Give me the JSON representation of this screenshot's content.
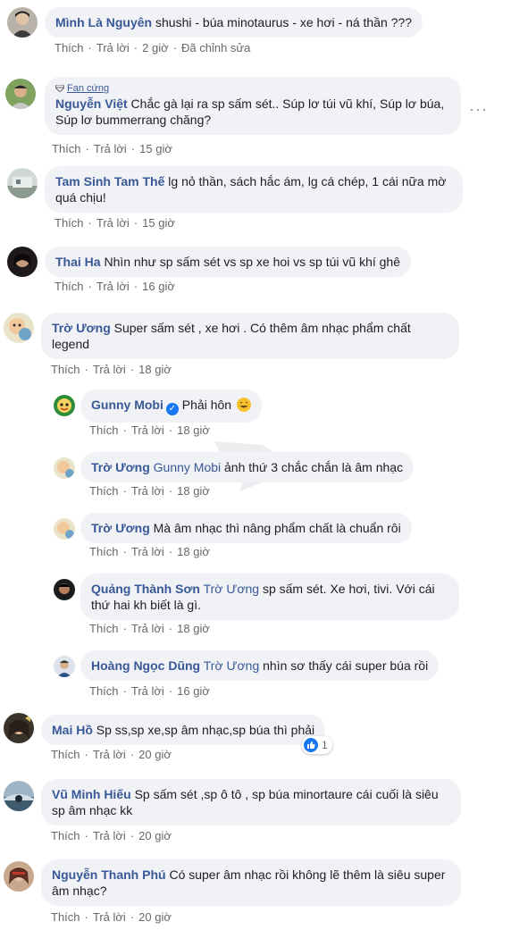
{
  "actions": {
    "like": "Thích",
    "reply": "Trả lời"
  },
  "colors": {
    "author": "#385898",
    "bubble": "#f0f2f5",
    "meta": "#65676b",
    "like_blue": "#1877f2"
  },
  "comments": [
    {
      "author": "Mình Là Nguyên",
      "text": "shushi - búa minotaurus - xe hơi - ná thần ???",
      "time": "2 giờ",
      "extra": "Đã chỉnh sửa"
    },
    {
      "badge": "Fan cứng",
      "author": "Nguyễn Việt",
      "text": "Chắc gà lại ra sp sấm sét.. Súp lơ túi vũ khí, Súp lơ búa, Súp lơ bummerrang chăng?",
      "time": "15 giờ",
      "more_icon": "more-options-icon"
    },
    {
      "author": "Tam Sinh Tam Thế",
      "text": "lg nỏ thần, sách hắc ám, lg cá chép, 1 cái nữa mờ quá chịu!",
      "time": "15 giờ"
    },
    {
      "author": "Thai Ha",
      "text": "Nhìn như sp sấm sét vs sp xe hoi vs sp túi vũ khí ghê",
      "time": "16 giờ"
    },
    {
      "author": "Trờ Ương",
      "text": "Super sấm sét , xe hơi . Có thêm âm nhạc phẩm chất legend",
      "time": "18 giờ"
    },
    {
      "author": "Gunny Mobi",
      "text": "Phải hôn",
      "time": "18 giờ",
      "verified_icon": "verified-badge-icon",
      "emoji": "grinning-emoji-icon"
    },
    {
      "author": "Trờ Ương",
      "mention": "Gunny Mobi",
      "text": "ảnh thứ 3 chắc chắn là âm nhạc",
      "time": "18 giờ"
    },
    {
      "author": "Trờ Ương",
      "text": "Mà âm nhạc thì nâng phẩm chất là chuẩn rôi",
      "time": "18 giờ"
    },
    {
      "author": "Quảng Thành Sơn",
      "mention": "Trờ Ương",
      "text": "sp sấm sét. Xe hơi, tivi. Với cái thứ hai kh biết là gì.",
      "time": "18 giờ"
    },
    {
      "author": "Hoàng Ngọc Dũng",
      "mention": "Trờ Ương",
      "text": "nhìn sơ thấy cái super búa rồi",
      "time": "16 giờ"
    },
    {
      "author": "Mai Hồ",
      "text": "Sp ss,sp xe,sp âm nhạc,sp búa thì phải",
      "time": "20 giờ",
      "reaction_count": "1",
      "reaction_icon": "like-reaction-icon"
    },
    {
      "author": "Vũ Minh Hiếu",
      "text": "Sp sấm sét ,sp ô tô , sp búa minortaure cái cuối là siêu sp âm nhạc kk",
      "time": "20 giờ"
    },
    {
      "author": "Nguyễn Thanh Phú",
      "text": "Có super âm nhạc rồi không lẽ thêm là siêu super âm nhạc?",
      "time": "20 giờ"
    }
  ]
}
